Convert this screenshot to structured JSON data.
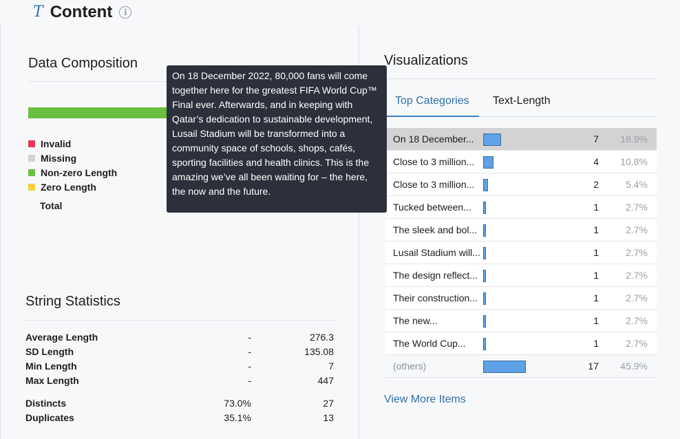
{
  "header": {
    "type_icon": "T",
    "title": "Content",
    "info_icon": "i"
  },
  "data_composition": {
    "title": "Data Composition",
    "bar_color": "#6abf40",
    "legend": [
      {
        "label": "Invalid",
        "color": "#e5395a"
      },
      {
        "label": "Missing",
        "color": "#d3d3d3"
      },
      {
        "label": "Non-zero Length",
        "color": "#6abf40"
      },
      {
        "label": "Zero Length",
        "color": "#f5d03b"
      }
    ],
    "total_label": "Total"
  },
  "string_statistics": {
    "title": "String Statistics",
    "rows": [
      {
        "label": "Average Length",
        "pct": "-",
        "value": "276.3"
      },
      {
        "label": "SD Length",
        "pct": "-",
        "value": "135.08"
      },
      {
        "label": "Min Length",
        "pct": "-",
        "value": "7"
      },
      {
        "label": "Max Length",
        "pct": "-",
        "value": "447"
      },
      {
        "label": "Distincts",
        "pct": "73.0%",
        "value": "27"
      },
      {
        "label": "Duplicates",
        "pct": "35.1%",
        "value": "13"
      }
    ]
  },
  "tooltip": {
    "text": "On 18 December 2022, 80,000 fans will come together here for the greatest FIFA World Cup™ Final ever. Afterwards, and in keeping with Qatar’s dedication to sustainable development, Lusail Stadium will be transformed into a community space of schools, shops, cafés, sporting facilities and health clinics. This is the amazing we’ve all been waiting for – the here, the now and the future."
  },
  "visualizations": {
    "title": "Visualizations",
    "tabs": [
      "Top Categories",
      "Text-Length"
    ],
    "active_tab": "Top Categories",
    "categories": [
      {
        "label": "On 18 December...",
        "count": "7",
        "pct": "18.9%",
        "share": 0.189
      },
      {
        "label": "Close to 3 million...",
        "count": "4",
        "pct": "10.8%",
        "share": 0.108
      },
      {
        "label": "Close to 3 million...",
        "count": "2",
        "pct": "5.4%",
        "share": 0.054
      },
      {
        "label": "Tucked between...",
        "count": "1",
        "pct": "2.7%",
        "share": 0.027
      },
      {
        "label": "The sleek and bol...",
        "count": "1",
        "pct": "2.7%",
        "share": 0.027
      },
      {
        "label": "Lusail Stadium will...",
        "count": "1",
        "pct": "2.7%",
        "share": 0.027
      },
      {
        "label": "The design reflect...",
        "count": "1",
        "pct": "2.7%",
        "share": 0.027
      },
      {
        "label": "Their construction...",
        "count": "1",
        "pct": "2.7%",
        "share": 0.027
      },
      {
        "label": "The new...",
        "count": "1",
        "pct": "2.7%",
        "share": 0.027
      },
      {
        "label": "The World Cup...",
        "count": "1",
        "pct": "2.7%",
        "share": 0.027
      },
      {
        "label": "(others)",
        "count": "17",
        "pct": "45.9%",
        "share": 0.459
      }
    ],
    "bar_color": "#5ea1e6",
    "selected_row": 0,
    "view_more": "View More Items"
  }
}
